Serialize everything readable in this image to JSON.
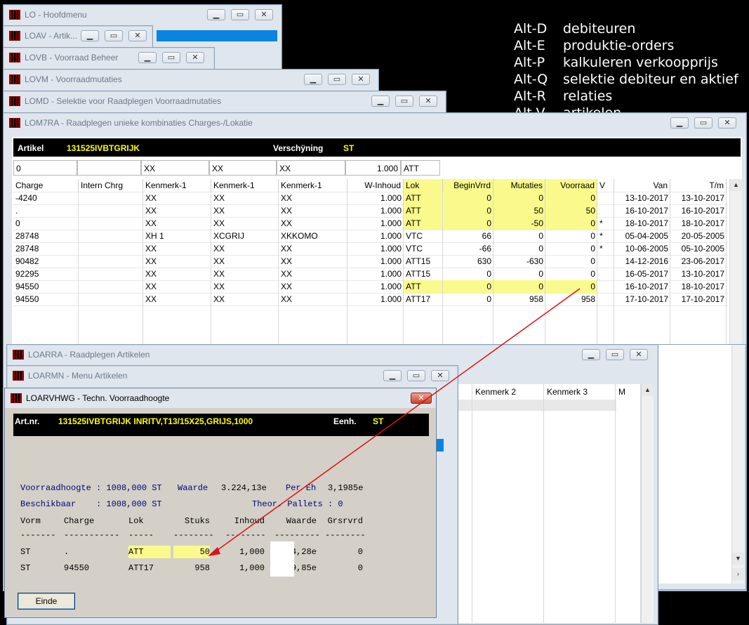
{
  "help": [
    {
      "key": "Alt-D",
      "text": "debiteuren"
    },
    {
      "key": "Alt-E",
      "text": "produktie-orders"
    },
    {
      "key": "Alt-P",
      "text": "kalkuleren verkoopprijs"
    },
    {
      "key": "Alt-Q",
      "text": "selektie debiteur en aktief"
    },
    {
      "key": "Alt-R",
      "text": "relaties"
    },
    {
      "key": "Alt-V",
      "text": "artikelen"
    }
  ],
  "windows": {
    "lo": "LO - Hoofdmenu",
    "loav": "LOAV - Artik...",
    "lovb": "LOVB - Voorraad Beheer",
    "lovm": "LOVM - Voorraadmutaties",
    "lomd": "LOMD - Selektie voor Raadplegen Voorraadmutaties",
    "lom7ra": "LOM7RA - Raadplegen unieke kombinaties Charges-/Lokatie",
    "loarra": "LOARRA - Raadplegen Artikelen",
    "loarmn": "LOARMN - Menu Artikelen",
    "loarvhwg": "LOARVHWG - Techn. Voorraadhoogte"
  },
  "lom7ra": {
    "artikel_label": "Artikel",
    "artikel_value": "131525IVBTGRIJK",
    "versch_label": "Verschÿning",
    "versch_value": "ST",
    "filter": [
      "0",
      "",
      "XX",
      "XX",
      "XX",
      "1.000",
      "ATT"
    ],
    "columns": [
      "Charge",
      "Intern Chrg",
      "Kenmerk-1",
      "Kenmerk-1",
      "Kenmerk-1",
      "W-Inhoud",
      "Lok",
      "BeginVrrd",
      "Mutaties",
      "Voorraad",
      "V",
      "Van",
      "T/m"
    ],
    "rows": [
      [
        "-4240",
        "",
        "XX",
        "XX",
        "XX",
        "1.000",
        "ATT",
        "0",
        "0",
        "0",
        "",
        "13-10-2017",
        "13-10-2017"
      ],
      [
        ".",
        "",
        "XX",
        "XX",
        "XX",
        "1.000",
        "ATT",
        "0",
        "50",
        "50",
        "",
        "16-10-2017",
        "16-10-2017"
      ],
      [
        "0",
        "",
        "XX",
        "XX",
        "XX",
        "1.000",
        "ATT",
        "0",
        "-50",
        "0",
        "*",
        "18-10-2017",
        "18-10-2017"
      ],
      [
        "28748",
        "",
        "XH        1",
        "XCGRIJ",
        "XKKOMO",
        "1.000",
        "VTC",
        "66",
        "0",
        "0",
        "*",
        "05-04-2005",
        "20-05-2005"
      ],
      [
        "28748",
        "",
        "XX",
        "XX",
        "XX",
        "1.000",
        "VTC",
        "-66",
        "0",
        "0",
        "*",
        "10-06-2005",
        "05-10-2005"
      ],
      [
        "90482",
        "",
        "XX",
        "XX",
        "XX",
        "1.000",
        "ATT15",
        "630",
        "-630",
        "0",
        "",
        "14-12-2016",
        "23-06-2017"
      ],
      [
        "92295",
        "",
        "XX",
        "XX",
        "XX",
        "1.000",
        "ATT15",
        "0",
        "0",
        "0",
        "",
        "16-05-2017",
        "13-10-2017"
      ],
      [
        "94550",
        "",
        "XX",
        "XX",
        "XX",
        "1.000",
        "ATT",
        "0",
        "0",
        "0",
        "",
        "16-10-2017",
        "18-10-2017"
      ],
      [
        "94550",
        "",
        "XX",
        "XX",
        "XX",
        "1.000",
        "ATT17",
        "0",
        "958",
        "958",
        "",
        "17-10-2017",
        "17-10-2017"
      ]
    ]
  },
  "loarra": {
    "columns": [
      "Kenmerk 2",
      "Kenmerk 3",
      "M"
    ]
  },
  "vh": {
    "artnr_label": "Art.nr.",
    "artnr_value": "131525IVBTGRIJK  INRITV,T13/15X25,GRIJS,1000",
    "eenh_label": "Eenh.",
    "eenh_value": "ST",
    "line1_a": "Voorraadhoogte : 1008,000 ST",
    "line1_b": "Waarde",
    "line1_c": "3.224,13e",
    "line1_d": "Per Eh",
    "line1_e": "3,1985e",
    "line2_a": "Beschikbaar    : 1008,000 ST",
    "line2_b": "Theor. Pallets : 0",
    "columns": [
      "Vorm",
      "Charge",
      "Lok",
      "Stuks",
      "Inhoud",
      "Waarde",
      "Grsrvrd"
    ],
    "dashes": [
      "-------",
      "-----------",
      "-----",
      "--------",
      "--------",
      "---------",
      "--------"
    ],
    "rows": [
      [
        "ST",
        ".",
        "ATT",
        "50",
        "1,000",
        "4,28e",
        "0"
      ],
      [
        "ST",
        "94550",
        "ATT17",
        "958",
        "1,000",
        "9,85e",
        "0"
      ]
    ],
    "button": "Einde"
  }
}
